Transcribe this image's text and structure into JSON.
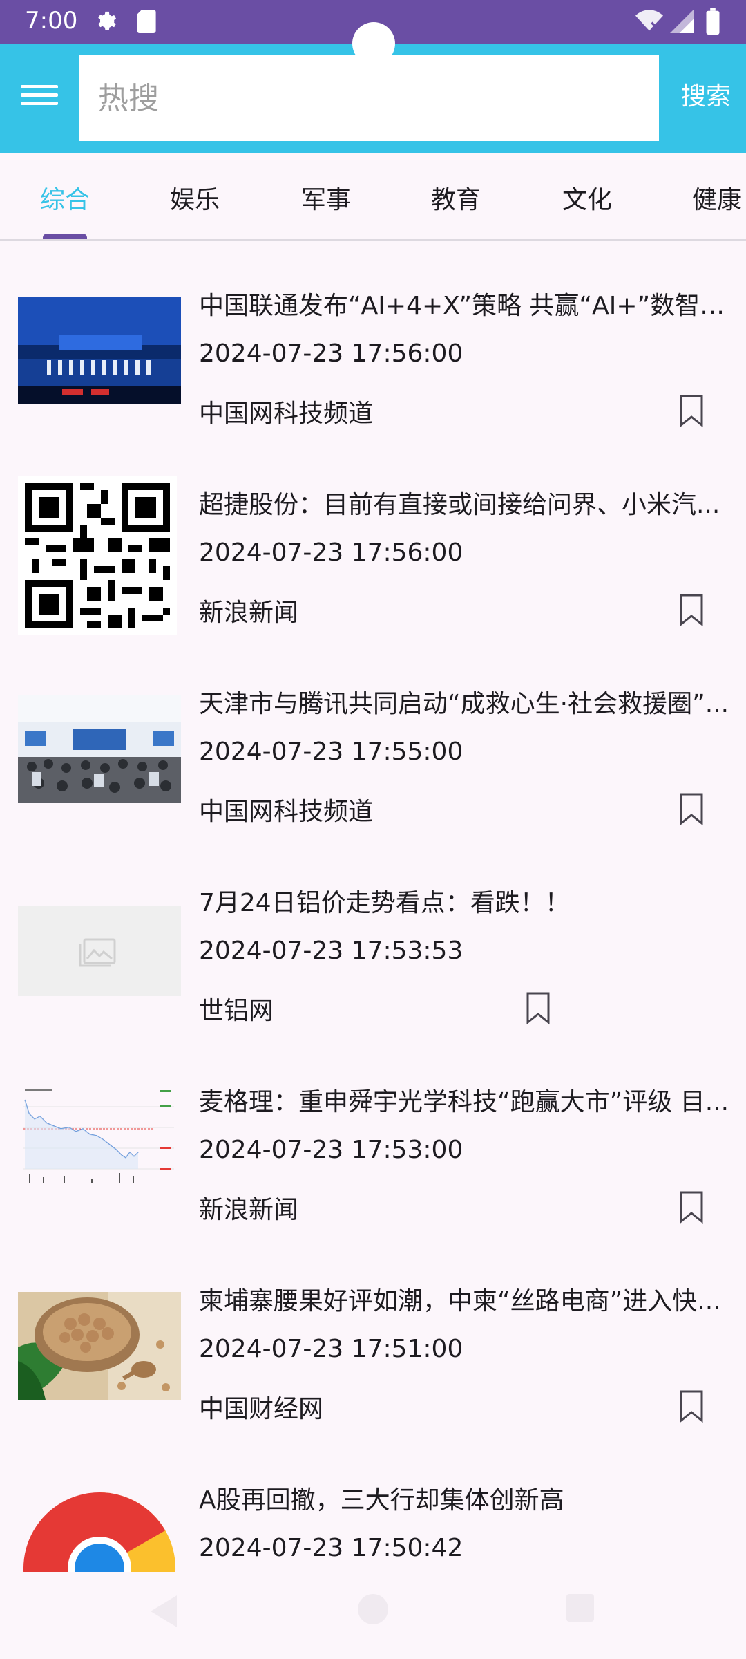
{
  "status_bar": {
    "time": "7:00"
  },
  "search": {
    "placeholder": "热搜",
    "value": "",
    "button_label": "搜索"
  },
  "tabs": [
    {
      "label": "综合",
      "active": true
    },
    {
      "label": "娱乐"
    },
    {
      "label": "军事"
    },
    {
      "label": "教育"
    },
    {
      "label": "文化"
    },
    {
      "label": "健康"
    }
  ],
  "news": [
    {
      "title": "中国联通发布“AI+4+X”策略 共赢“AI+”数智新...",
      "date": "2024-07-23 17:56:00",
      "source": "中国网科技频道",
      "thumb": "conference-stage-photo"
    },
    {
      "title": "超捷股份：目前有直接或间接给问界、小米汽...",
      "date": "2024-07-23 17:56:00",
      "source": "新浪新闻",
      "thumb": "qr-code"
    },
    {
      "title": "天津市与腾讯共同启动“成救心生·社会救援圈”...",
      "date": "2024-07-23 17:55:00",
      "source": "中国网科技频道",
      "thumb": "meeting-hall-photo"
    },
    {
      "title": "7月24日铝价走势看点：看跌！！",
      "date": "2024-07-23 17:53:53",
      "source": "世铝网",
      "thumb": "image-placeholder"
    },
    {
      "title": "麦格理：重申舜宇光学科技“跑赢大市”评级 目...",
      "date": "2024-07-23 17:53:00",
      "source": "新浪新闻",
      "thumb": "stock-chart"
    },
    {
      "title": "柬埔寨腰果好评如潮，中柬“丝路电商”进入快...",
      "date": "2024-07-23 17:51:00",
      "source": "中国财经网",
      "thumb": "cashew-photo"
    },
    {
      "title": "A股再回撤，三大行却集体创新高",
      "date": "2024-07-23 17:50:42",
      "source": "",
      "thumb": "chrome-logo"
    }
  ],
  "colors": {
    "status_bar": "#6a4ea4",
    "header": "#36c3e7",
    "active_tab": "#36c3e7",
    "indicator": "#6a4ea4",
    "background": "#fcf6fb"
  }
}
